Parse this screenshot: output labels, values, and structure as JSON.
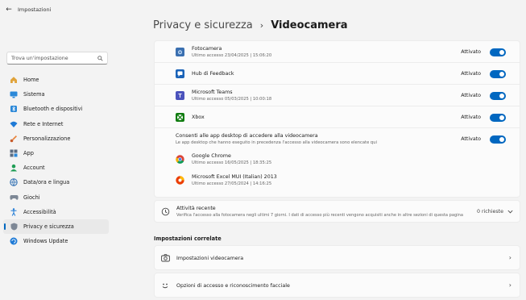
{
  "window": {
    "back_icon": "back-arrow-icon",
    "title": "Impostazioni"
  },
  "search": {
    "placeholder": "Trova un'impostazione",
    "icon": "search-icon"
  },
  "nav": [
    {
      "label": "Home",
      "icon": "home-icon"
    },
    {
      "label": "Sistema",
      "icon": "system-icon"
    },
    {
      "label": "Bluetooth e dispositivi",
      "icon": "bluetooth-icon"
    },
    {
      "label": "Rete e Internet",
      "icon": "network-icon"
    },
    {
      "label": "Personalizzazione",
      "icon": "brush-icon"
    },
    {
      "label": "App",
      "icon": "apps-icon"
    },
    {
      "label": "Account",
      "icon": "account-icon"
    },
    {
      "label": "Data/ora e lingua",
      "icon": "globe-clock-icon"
    },
    {
      "label": "Giochi",
      "icon": "gamepad-icon"
    },
    {
      "label": "Accessibilità",
      "icon": "accessibility-icon"
    },
    {
      "label": "Privacy e sicurezza",
      "icon": "shield-icon",
      "active": true
    },
    {
      "label": "Windows Update",
      "icon": "update-icon"
    }
  ],
  "breadcrumb": {
    "parent": "Privacy e sicurezza",
    "separator": "›",
    "current": "Videocamera"
  },
  "apps": [
    {
      "name": "Fotocamera",
      "sub": "Ultimo accesso 23/04/2025  |  15:06:20",
      "status": "Attivato",
      "on": true,
      "icon": "camera-app-icon"
    },
    {
      "name": "Hub di Feedback",
      "sub": "",
      "status": "Attivato",
      "on": true,
      "icon": "feedback-hub-icon"
    },
    {
      "name": "Microsoft Teams",
      "sub": "Ultimo accesso 05/03/2025  |  10:00:18",
      "status": "Attivato",
      "on": true,
      "icon": "teams-icon"
    },
    {
      "name": "Xbox",
      "sub": "",
      "status": "Attivato",
      "on": true,
      "icon": "xbox-icon"
    }
  ],
  "desktop": {
    "title": "Consenti alle app desktop di accedere alla videocamera",
    "sub": "Le app desktop che hanno eseguito in precedenza l'accesso alla videocamera sono elencate qui",
    "status": "Attivato",
    "on": true,
    "apps": [
      {
        "name": "Google Chrome",
        "sub": "Ultimo accesso 16/05/2025  |  18:35:25",
        "icon": "chrome-icon"
      },
      {
        "name": "Microsoft Excel MUI (Italian) 2013",
        "sub": "Ultimo accesso 27/05/2024  |  14:16:25",
        "icon": "office-icon"
      }
    ]
  },
  "recent": {
    "title": "Attività recente",
    "sub": "Verifica l'accesso alla fotocamera negli ultimi 7 giorni. I dati di accesso più recenti vengono acquisiti anche in altre sezioni di questa pagina",
    "count": "0 richieste",
    "icon": "history-icon"
  },
  "related": {
    "label": "Impostazioni correlate",
    "items": [
      {
        "label": "Impostazioni videocamera",
        "icon": "camera-outline-icon"
      },
      {
        "label": "Opzioni di accesso e riconoscimento facciale",
        "icon": "face-icon"
      }
    ]
  },
  "colors": {
    "accent": "#0067c0",
    "background": "#f3f3f3",
    "card": "#fbfbfb"
  }
}
